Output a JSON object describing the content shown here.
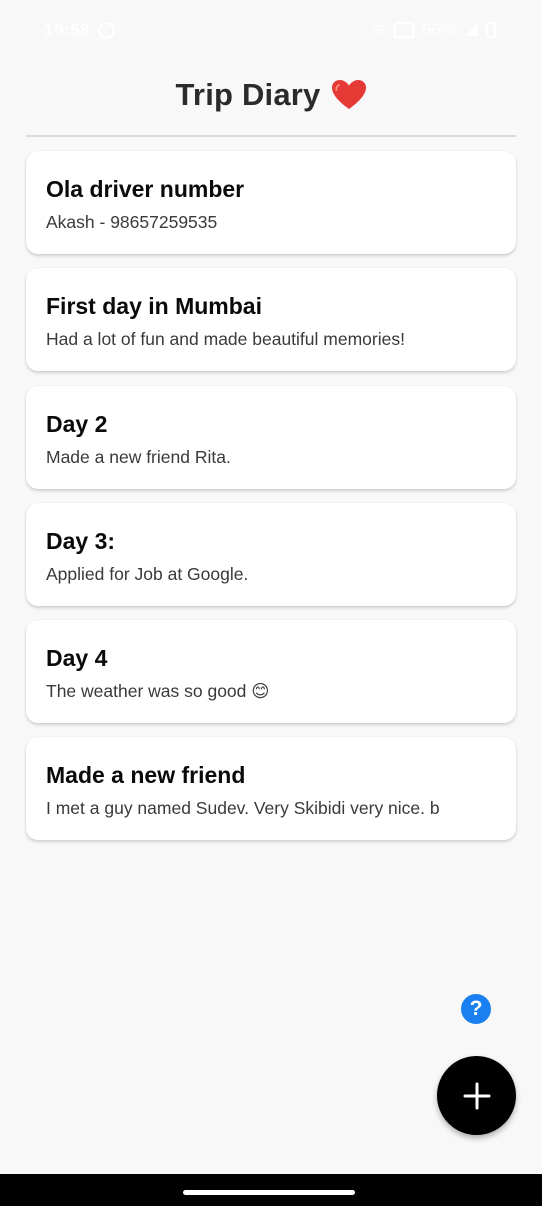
{
  "status_bar": {
    "time": "10:58",
    "battery": "56%",
    "icons": [
      "whatsapp-icon",
      "vowifi-icon",
      "signal-icon",
      "battery-icon"
    ]
  },
  "header": {
    "title": "Trip Diary",
    "title_icon": "heart-icon",
    "heart_color": "#e53935"
  },
  "notes": [
    {
      "title": "Ola driver number",
      "body": "Akash - 98657259535"
    },
    {
      "title": "First day in Mumbai",
      "body": "Had a lot of fun and made beautiful memories!"
    },
    {
      "title": "Day 2",
      "body": "Made a new friend Rita."
    },
    {
      "title": "Day 3:",
      "body": "Applied for Job at Google."
    },
    {
      "title": "Day 4",
      "body": "The weather was so good 😊"
    },
    {
      "title": "Made a new friend",
      "body": "I met a guy named Sudev. Very Skibidi very nice. b"
    }
  ],
  "help_button": {
    "label": "?",
    "color": "#1a7ff0"
  },
  "fab": {
    "icon": "plus-icon",
    "color": "#000000"
  }
}
